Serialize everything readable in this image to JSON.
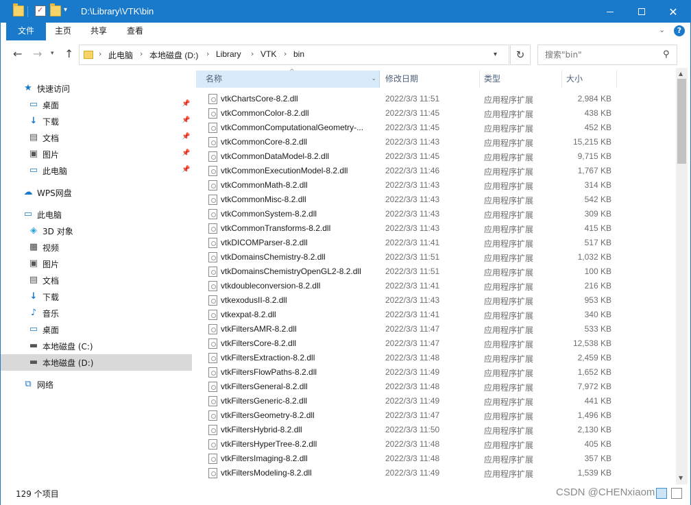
{
  "window": {
    "title": "D:\\Library\\VTK\\bin",
    "accent": "#1979ca"
  },
  "ribbon": {
    "tabs": [
      "文件",
      "主页",
      "共享",
      "查看"
    ]
  },
  "address": {
    "crumbs": [
      "此电脑",
      "本地磁盘 (D:)",
      "Library",
      "VTK",
      "bin"
    ]
  },
  "search": {
    "placeholder": "搜索\"bin\""
  },
  "sidebar": {
    "items": [
      {
        "label": "快速访问",
        "icon": "star-icon"
      },
      {
        "label": "桌面",
        "icon": "desktop-icon"
      },
      {
        "label": "下载",
        "icon": "download-icon"
      },
      {
        "label": "文档",
        "icon": "document-icon"
      },
      {
        "label": "图片",
        "icon": "picture-icon"
      },
      {
        "label": "此电脑",
        "icon": "computer-icon"
      },
      {
        "label": "WPS网盘",
        "icon": "cloud-icon"
      },
      {
        "label": "此电脑",
        "icon": "computer-icon"
      },
      {
        "label": "3D 对象",
        "icon": "cube-icon"
      },
      {
        "label": "视频",
        "icon": "video-icon"
      },
      {
        "label": "图片",
        "icon": "picture-icon"
      },
      {
        "label": "文档",
        "icon": "document-icon"
      },
      {
        "label": "下载",
        "icon": "download-icon"
      },
      {
        "label": "音乐",
        "icon": "music-icon"
      },
      {
        "label": "桌面",
        "icon": "desktop-icon"
      },
      {
        "label": "本地磁盘 (C:)",
        "icon": "drive-icon"
      },
      {
        "label": "本地磁盘 (D:)",
        "icon": "drive-icon"
      },
      {
        "label": "网络",
        "icon": "network-icon"
      }
    ]
  },
  "columns": {
    "name": "名称",
    "date": "修改日期",
    "type": "类型",
    "size": "大小"
  },
  "files": [
    {
      "name": "vtkChartsCore-8.2.dll",
      "date": "2022/3/3 11:51",
      "type": "应用程序扩展",
      "size": "2,984 KB"
    },
    {
      "name": "vtkCommonColor-8.2.dll",
      "date": "2022/3/3 11:45",
      "type": "应用程序扩展",
      "size": "438 KB"
    },
    {
      "name": "vtkCommonComputationalGeometry-...",
      "date": "2022/3/3 11:45",
      "type": "应用程序扩展",
      "size": "452 KB"
    },
    {
      "name": "vtkCommonCore-8.2.dll",
      "date": "2022/3/3 11:43",
      "type": "应用程序扩展",
      "size": "15,215 KB"
    },
    {
      "name": "vtkCommonDataModel-8.2.dll",
      "date": "2022/3/3 11:45",
      "type": "应用程序扩展",
      "size": "9,715 KB"
    },
    {
      "name": "vtkCommonExecutionModel-8.2.dll",
      "date": "2022/3/3 11:46",
      "type": "应用程序扩展",
      "size": "1,767 KB"
    },
    {
      "name": "vtkCommonMath-8.2.dll",
      "date": "2022/3/3 11:43",
      "type": "应用程序扩展",
      "size": "314 KB"
    },
    {
      "name": "vtkCommonMisc-8.2.dll",
      "date": "2022/3/3 11:43",
      "type": "应用程序扩展",
      "size": "542 KB"
    },
    {
      "name": "vtkCommonSystem-8.2.dll",
      "date": "2022/3/3 11:43",
      "type": "应用程序扩展",
      "size": "309 KB"
    },
    {
      "name": "vtkCommonTransforms-8.2.dll",
      "date": "2022/3/3 11:43",
      "type": "应用程序扩展",
      "size": "415 KB"
    },
    {
      "name": "vtkDICOMParser-8.2.dll",
      "date": "2022/3/3 11:41",
      "type": "应用程序扩展",
      "size": "517 KB"
    },
    {
      "name": "vtkDomainsChemistry-8.2.dll",
      "date": "2022/3/3 11:51",
      "type": "应用程序扩展",
      "size": "1,032 KB"
    },
    {
      "name": "vtkDomainsChemistryOpenGL2-8.2.dll",
      "date": "2022/3/3 11:51",
      "type": "应用程序扩展",
      "size": "100 KB"
    },
    {
      "name": "vtkdoubleconversion-8.2.dll",
      "date": "2022/3/3 11:41",
      "type": "应用程序扩展",
      "size": "216 KB"
    },
    {
      "name": "vtkexodusII-8.2.dll",
      "date": "2022/3/3 11:43",
      "type": "应用程序扩展",
      "size": "953 KB"
    },
    {
      "name": "vtkexpat-8.2.dll",
      "date": "2022/3/3 11:41",
      "type": "应用程序扩展",
      "size": "340 KB"
    },
    {
      "name": "vtkFiltersAMR-8.2.dll",
      "date": "2022/3/3 11:47",
      "type": "应用程序扩展",
      "size": "533 KB"
    },
    {
      "name": "vtkFiltersCore-8.2.dll",
      "date": "2022/3/3 11:47",
      "type": "应用程序扩展",
      "size": "12,538 KB"
    },
    {
      "name": "vtkFiltersExtraction-8.2.dll",
      "date": "2022/3/3 11:48",
      "type": "应用程序扩展",
      "size": "2,459 KB"
    },
    {
      "name": "vtkFiltersFlowPaths-8.2.dll",
      "date": "2022/3/3 11:49",
      "type": "应用程序扩展",
      "size": "1,652 KB"
    },
    {
      "name": "vtkFiltersGeneral-8.2.dll",
      "date": "2022/3/3 11:48",
      "type": "应用程序扩展",
      "size": "7,972 KB"
    },
    {
      "name": "vtkFiltersGeneric-8.2.dll",
      "date": "2022/3/3 11:49",
      "type": "应用程序扩展",
      "size": "441 KB"
    },
    {
      "name": "vtkFiltersGeometry-8.2.dll",
      "date": "2022/3/3 11:47",
      "type": "应用程序扩展",
      "size": "1,496 KB"
    },
    {
      "name": "vtkFiltersHybrid-8.2.dll",
      "date": "2022/3/3 11:50",
      "type": "应用程序扩展",
      "size": "2,130 KB"
    },
    {
      "name": "vtkFiltersHyperTree-8.2.dll",
      "date": "2022/3/3 11:48",
      "type": "应用程序扩展",
      "size": "405 KB"
    },
    {
      "name": "vtkFiltersImaging-8.2.dll",
      "date": "2022/3/3 11:48",
      "type": "应用程序扩展",
      "size": "357 KB"
    },
    {
      "name": "vtkFiltersModeling-8.2.dll",
      "date": "2022/3/3 11:49",
      "type": "应用程序扩展",
      "size": "1,539 KB"
    }
  ],
  "status": {
    "count": "129 个项目",
    "watermark": "CSDN @CHENxiaom"
  }
}
